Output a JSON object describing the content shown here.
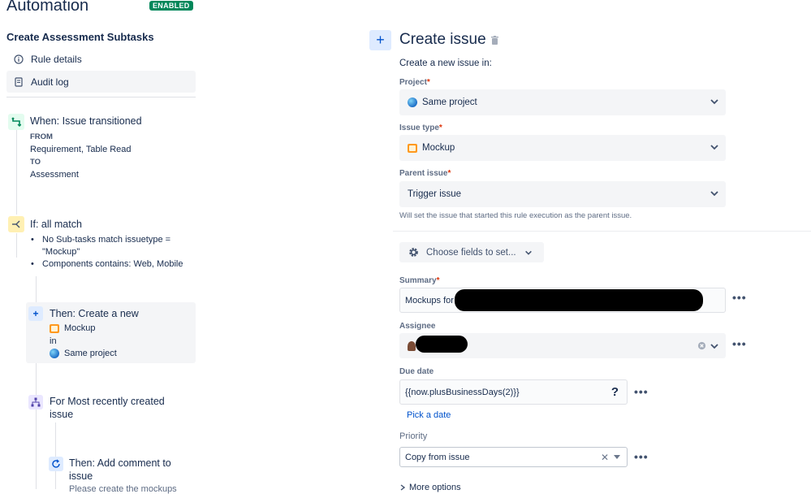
{
  "header": {
    "title": "Automation",
    "status_badge": "ENABLED"
  },
  "sidebar": {
    "rule_name": "Create Assessment Subtasks",
    "items": [
      {
        "label": "Rule details",
        "icon": "info-icon"
      },
      {
        "label": "Audit log",
        "icon": "document-icon"
      }
    ]
  },
  "flow": {
    "trigger": {
      "title": "When: Issue transitioned",
      "from_label": "FROM",
      "from_value": "Requirement, Table Read",
      "to_label": "TO",
      "to_value": "Assessment"
    },
    "condition": {
      "title": "If: all match",
      "bullets": [
        "No Sub-tasks match issuetype =",
        "\"Mockup\"",
        "Components contains: Web, Mobile"
      ]
    },
    "action": {
      "title": "Then: Create a new",
      "issue_type": "Mockup",
      "in": "in",
      "project": "Same project"
    },
    "branch": {
      "title_line1": "For Most recently created",
      "title_line2": "issue"
    },
    "comment": {
      "title_line1": "Then: Add comment to",
      "title_line2": "issue",
      "body_partial": "Please create the mockups"
    }
  },
  "panel": {
    "title": "Create issue",
    "intro": "Create a new issue in:",
    "project": {
      "label": "Project",
      "value": "Same project"
    },
    "issue_type": {
      "label": "Issue type",
      "value": "Mockup"
    },
    "parent_issue": {
      "label": "Parent issue",
      "value": "Trigger issue",
      "help": "Will set the issue that started this rule execution as the parent issue."
    },
    "choose_fields": "Choose fields to set...",
    "summary": {
      "label": "Summary",
      "value": "Mockups for"
    },
    "assignee": {
      "label": "Assignee"
    },
    "due_date": {
      "label": "Due date",
      "value": "{{now.plusBusinessDays(2)}}",
      "help_icon": "?",
      "pick_link": "Pick a date"
    },
    "priority": {
      "label": "Priority",
      "value": "Copy from issue"
    },
    "more_options": "More options",
    "required_mark": "*",
    "menu_dots": "•••"
  },
  "colors": {
    "accent": "#0052cc",
    "badge": "#00875a",
    "required": "#de350b"
  }
}
